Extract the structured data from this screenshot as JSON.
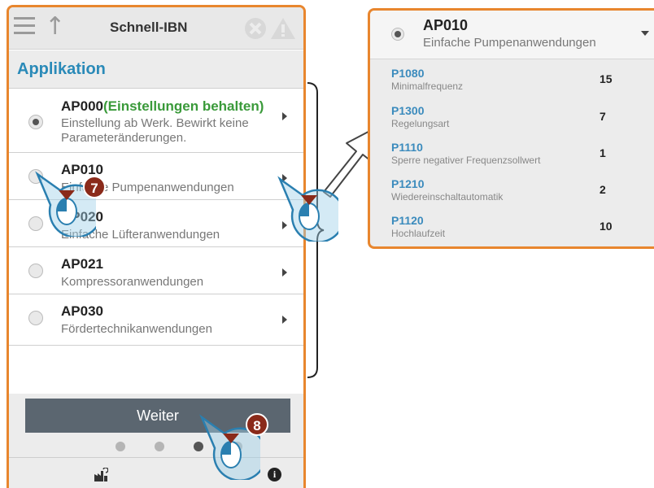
{
  "left_panel": {
    "title": "Schnell-IBN",
    "section": "Applikation",
    "items": [
      {
        "code": "AP000",
        "extra": "(Einstellungen behalten)",
        "desc": "Einstellung ab Werk. Bewirkt keine Parameteränderungen.",
        "selected": true
      },
      {
        "code": "AP010",
        "desc": "Einfache Pumpenanwendungen",
        "selected": false
      },
      {
        "code": "AP020",
        "desc": "Einfache Lüfteranwendungen",
        "selected": false
      },
      {
        "code": "AP021",
        "desc": "Kompressoranwendungen",
        "selected": false
      },
      {
        "code": "AP030",
        "desc": "Fördertechnikanwendungen",
        "selected": false
      }
    ],
    "next_button": "Weiter",
    "pager": {
      "count": 4,
      "active_index": 2
    }
  },
  "right_panel": {
    "code": "AP010",
    "desc": "Einfache Pumpenanwendungen",
    "params": [
      {
        "code": "P1080",
        "name": "Minimalfrequenz",
        "value": "15"
      },
      {
        "code": "P1300",
        "name": "Regelungsart",
        "value": "7"
      },
      {
        "code": "P1110",
        "name": "Sperre negativer Frequenzsollwert",
        "value": "1"
      },
      {
        "code": "P1210",
        "name": "Wiedereinschaltautomatik",
        "value": "2"
      },
      {
        "code": "P1120",
        "name": "Hochlaufzeit",
        "value": "10"
      }
    ]
  },
  "step_badges": {
    "first": "7",
    "second": "8"
  },
  "colors": {
    "frame": "#e8862e",
    "accent_blue": "#2a8ab8",
    "keep_green": "#3a9a3a",
    "badge": "#8a2a1a",
    "button": "#5b6670"
  },
  "icons": [
    "menu-icon",
    "up-arrow-icon",
    "close-icon",
    "warning-icon",
    "chevron-right-icon",
    "chevron-down-icon",
    "factory-reset-icon",
    "info-icon",
    "mouse-cursor-icon"
  ]
}
